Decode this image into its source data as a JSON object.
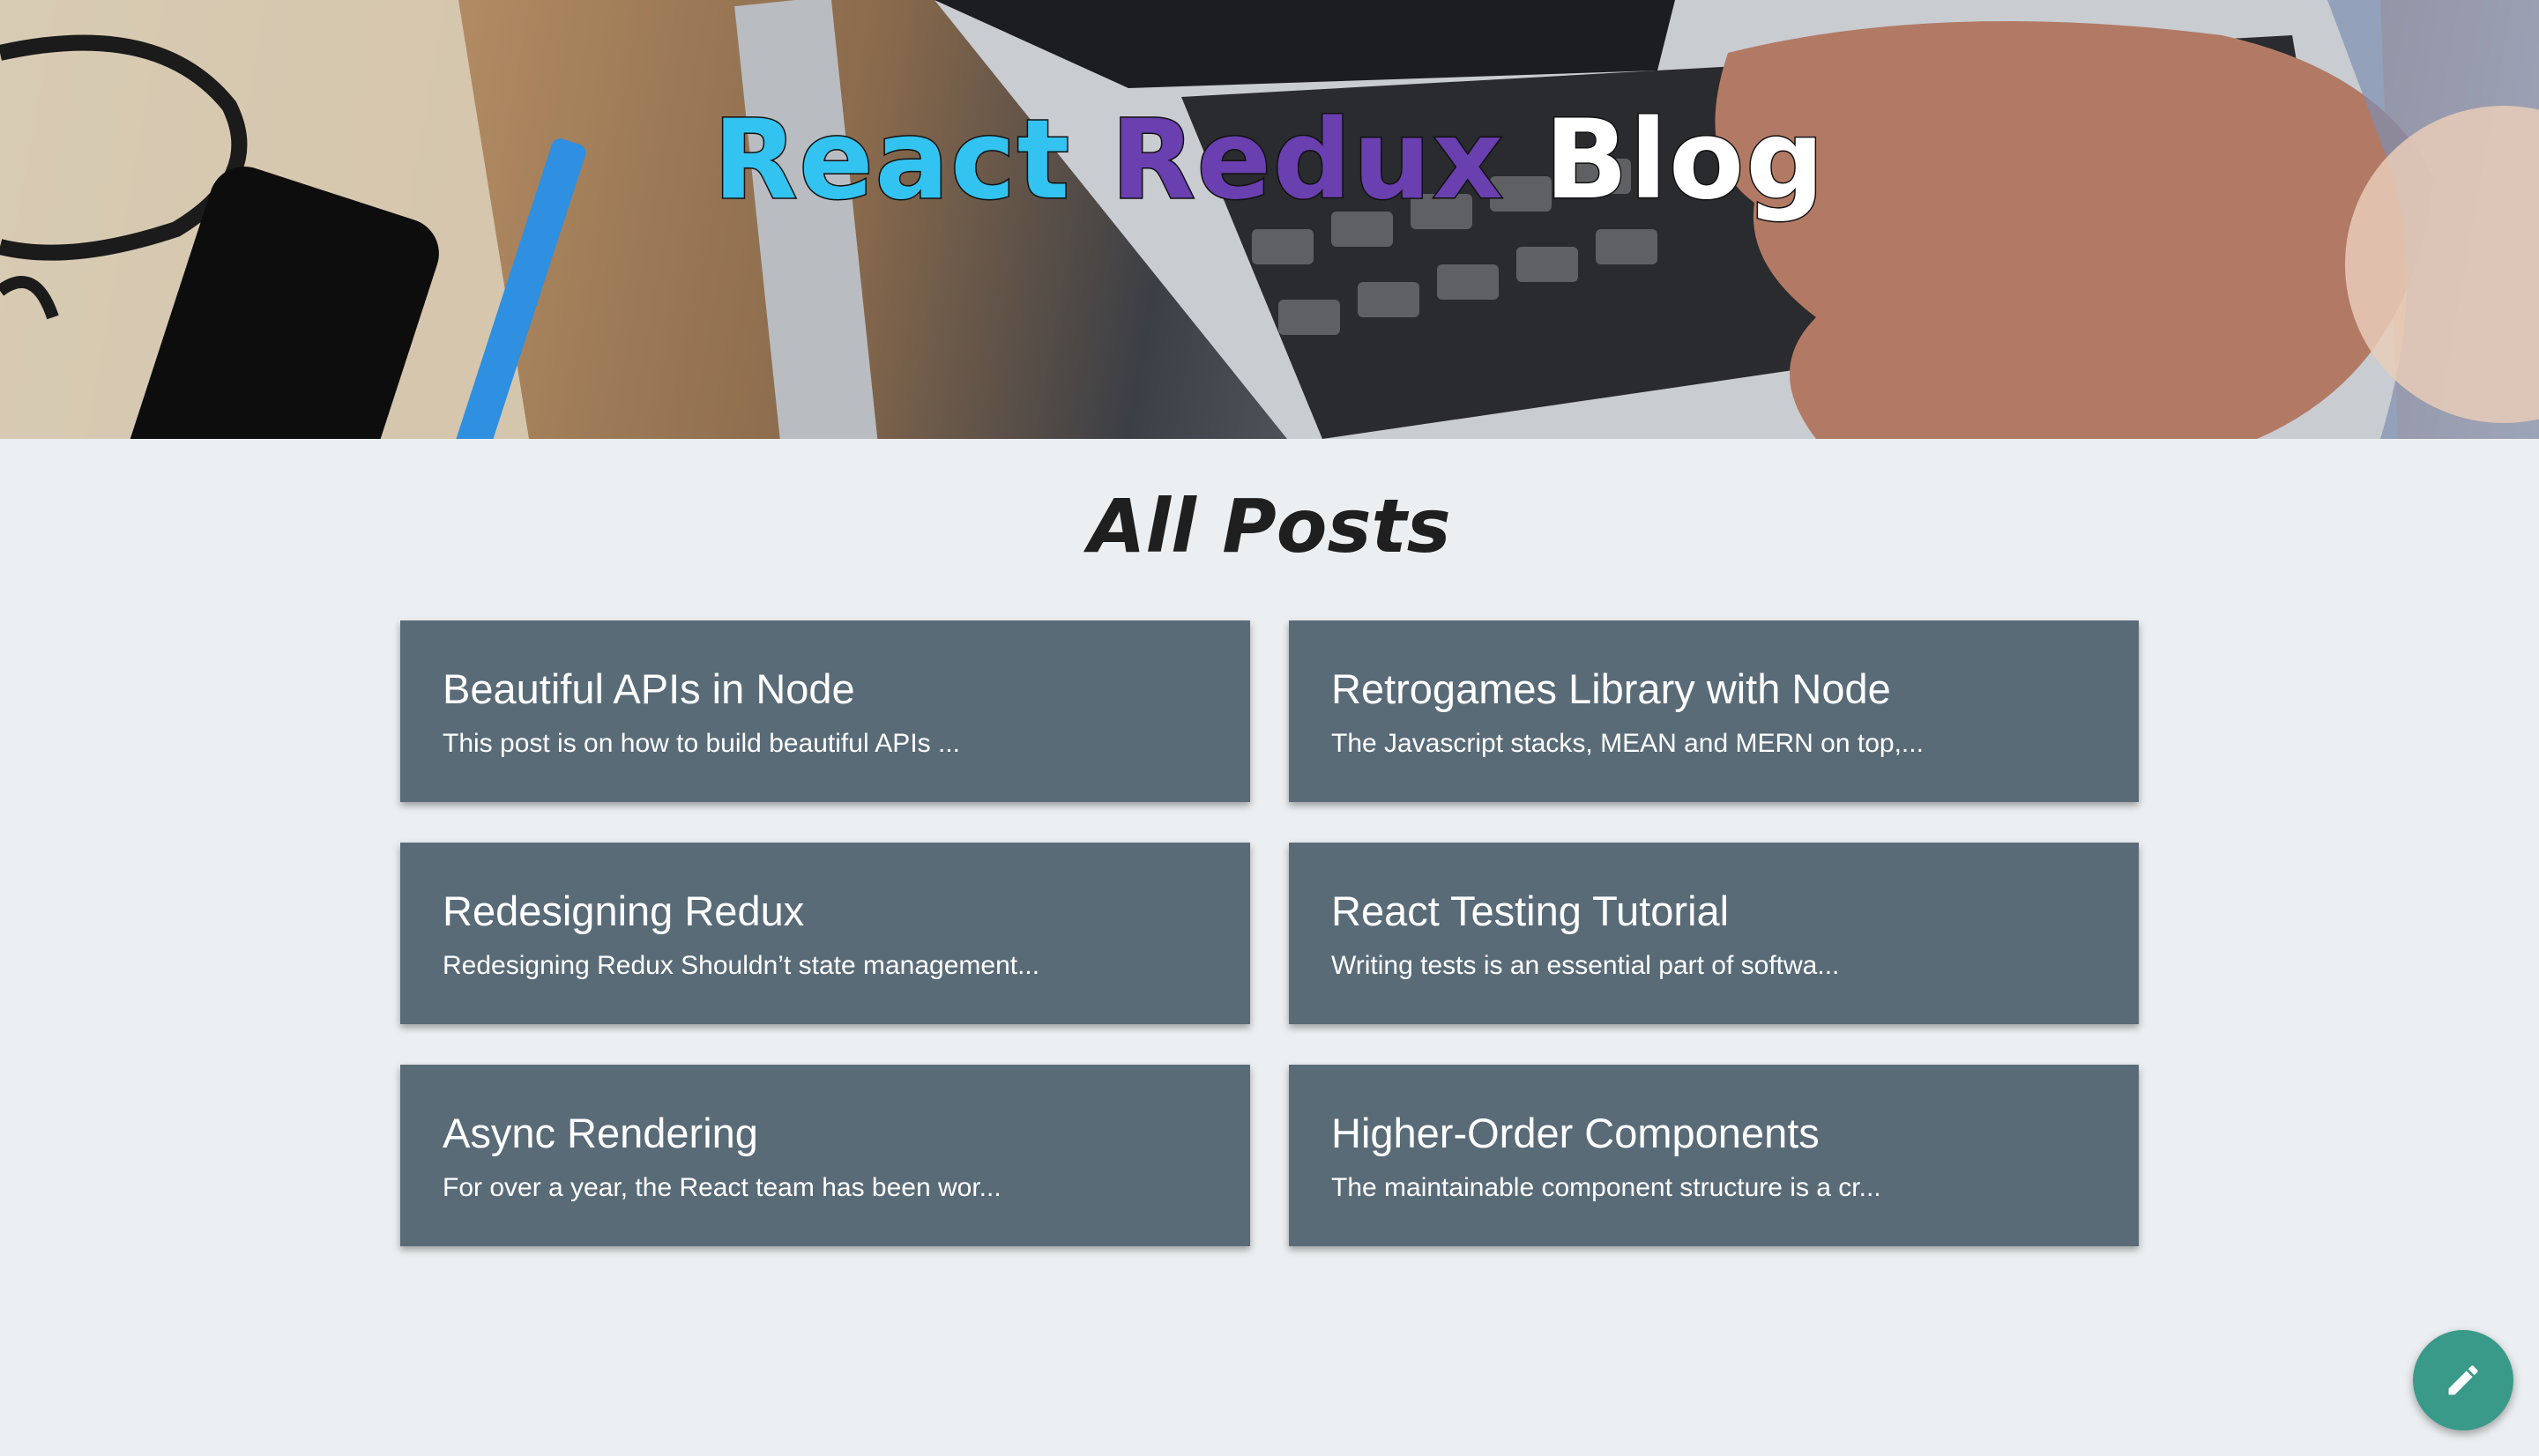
{
  "header": {
    "title_part1": "React",
    "title_part2": "Redux",
    "title_part3": "Blog"
  },
  "main": {
    "heading": "All Posts",
    "posts": [
      {
        "title": "Beautiful APIs in Node",
        "excerpt": "This post is on how to build beautiful APIs ..."
      },
      {
        "title": "Retrogames Library with Node",
        "excerpt": "The Javascript stacks, MEAN and MERN on top,..."
      },
      {
        "title": "Redesigning Redux",
        "excerpt": "Redesigning Redux Shouldn’t state management..."
      },
      {
        "title": "React Testing Tutorial",
        "excerpt": "Writing tests is an essential part of softwa..."
      },
      {
        "title": "Async Rendering",
        "excerpt": "For over a year, the React team has been wor..."
      },
      {
        "title": "Higher-Order Components",
        "excerpt": "The maintainable component structure is a cr..."
      }
    ]
  },
  "fab": {
    "icon": "pencil-icon"
  },
  "colors": {
    "title_react": "#33c3f0",
    "title_redux": "#6a3fb0",
    "title_blog": "#ffffff",
    "card_background": "#5a6b78",
    "page_background": "#eceff1",
    "fab_background": "#3a9a8a"
  }
}
